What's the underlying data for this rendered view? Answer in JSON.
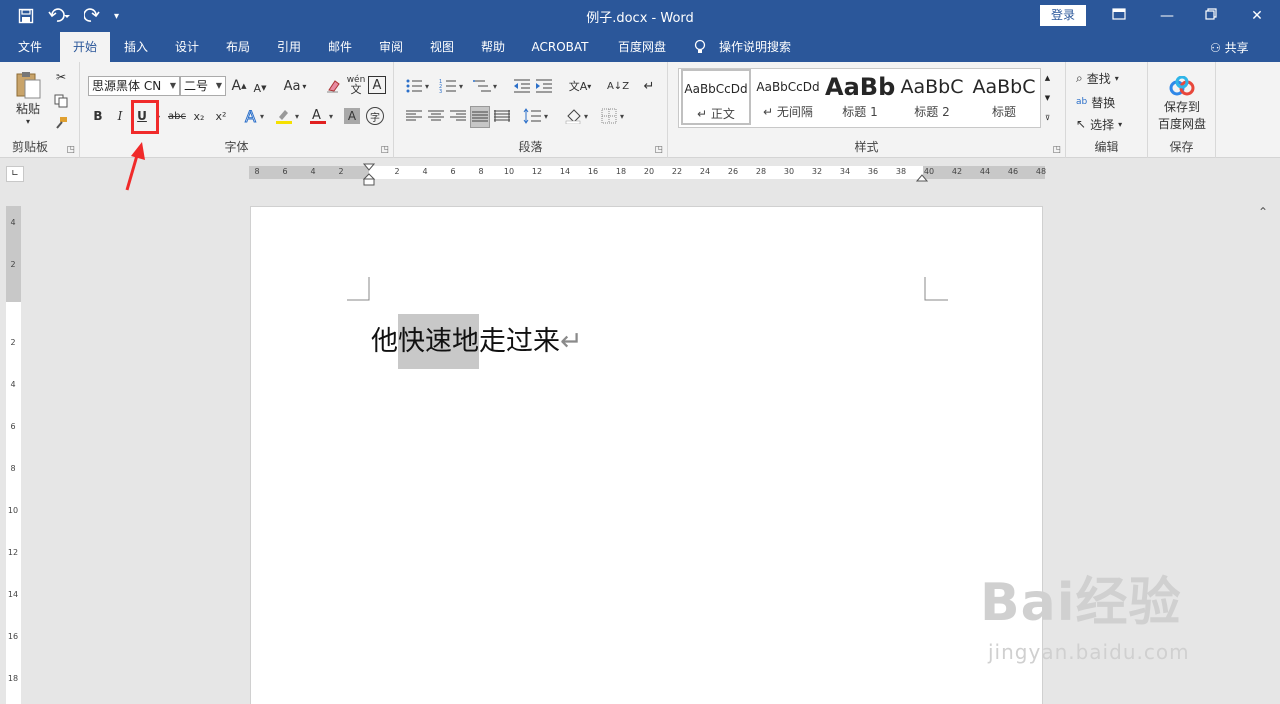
{
  "window": {
    "title": "例子.docx  -  Word",
    "login": "登录",
    "qat": [
      "save-icon",
      "undo-icon",
      "redo-icon",
      "customize-icon"
    ]
  },
  "tabs": {
    "file": "文件",
    "home": "开始",
    "insert": "插入",
    "design": "设计",
    "layout": "布局",
    "references": "引用",
    "mailings": "邮件",
    "review": "审阅",
    "view": "视图",
    "help": "帮助",
    "acrobat": "ACROBAT",
    "baidu": "百度网盘",
    "tellme": "操作说明搜索",
    "share": "共享"
  },
  "ribbon": {
    "clipboard": {
      "paste": "粘贴",
      "label": "剪贴板"
    },
    "font": {
      "name": "思源黑体 CN",
      "size": "二号",
      "label": "字体",
      "bold": "B",
      "italic": "I",
      "underline": "U",
      "strike": "abc",
      "sub": "x₂",
      "sup": "x²",
      "grow": "A",
      "shrink": "A",
      "case": "Aa",
      "wen": "wén",
      "border_a": "A"
    },
    "paragraph": {
      "label": "段落"
    },
    "styles": {
      "label": "样式",
      "items": [
        {
          "preview": "AaBbCcDd",
          "name": "正文"
        },
        {
          "preview": "AaBbCcDd",
          "name": "无间隔"
        },
        {
          "preview": "AaBb",
          "name": "标题 1"
        },
        {
          "preview": "AaBbC",
          "name": "标题 2"
        },
        {
          "preview": "AaBbC",
          "name": "标题"
        }
      ]
    },
    "editing": {
      "find": "查找",
      "replace": "替换",
      "select": "选择",
      "label": "编辑"
    },
    "save": {
      "line1": "保存到",
      "line2": "百度网盘",
      "label": "保存"
    }
  },
  "ruler": {
    "h_left": [
      "8",
      "6",
      "4",
      "2"
    ],
    "h_right": [
      "2",
      "4",
      "6",
      "8",
      "10",
      "12",
      "14",
      "16",
      "18",
      "20",
      "22",
      "24",
      "26",
      "28",
      "30",
      "32",
      "34",
      "36",
      "38",
      "40",
      "42",
      "44",
      "46",
      "48"
    ],
    "v_top": [
      "4",
      "2"
    ],
    "v_body": [
      "2",
      "4",
      "6",
      "8",
      "10",
      "12",
      "14",
      "16",
      "18"
    ]
  },
  "document": {
    "before": "他",
    "selected": "快速地",
    "after": "走过来",
    "mark": "↵"
  },
  "watermark": {
    "main": "Bai经验",
    "sub": "jingyan.baidu.com"
  },
  "colors": {
    "accent": "#2b579a",
    "highlight": "#f02a2a"
  }
}
